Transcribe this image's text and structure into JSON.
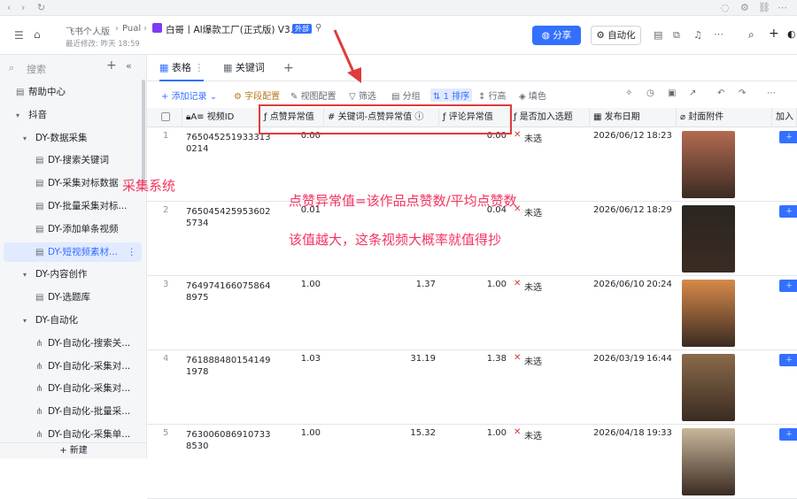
{
  "browser": {
    "back": "‹",
    "forward": "›",
    "reload": "↻"
  },
  "header": {
    "crumb1": "飞书个人版",
    "crumb2": "Pual",
    "doc_title": "白哥丨AI爆款工厂(正式版) V3.5",
    "badge": "外部",
    "last_modified": "最近修改: 昨天 18:59",
    "share": "分享",
    "automation": "自动化"
  },
  "sidebar": {
    "search": "搜索",
    "new": "新建",
    "items": [
      {
        "label": "帮助中心",
        "level": 0,
        "icon": "table-icon"
      },
      {
        "label": "抖音",
        "level": 0,
        "caret": true
      },
      {
        "label": "DY-数据采集",
        "level": 1,
        "caret": true
      },
      {
        "label": "DY-搜索关键词",
        "level": 2,
        "icon": "table-icon"
      },
      {
        "label": "DY-采集对标数据",
        "level": 2,
        "icon": "table-icon"
      },
      {
        "label": "DY-批量采集对标...",
        "level": 2,
        "icon": "table-icon"
      },
      {
        "label": "DY-添加单条视频",
        "level": 2,
        "icon": "table-icon"
      },
      {
        "label": "DY-短视频素材...",
        "level": 2,
        "icon": "table-icon",
        "active": true
      },
      {
        "label": "DY-内容创作",
        "level": 1,
        "caret": true
      },
      {
        "label": "DY-选题库",
        "level": 2,
        "icon": "table-icon"
      },
      {
        "label": "DY-自动化",
        "level": 1,
        "caret": true
      },
      {
        "label": "DY-自动化-搜索关...",
        "level": 2,
        "icon": "flow-icon"
      },
      {
        "label": "DY-自动化-采集对...",
        "level": 2,
        "icon": "flow-icon"
      },
      {
        "label": "DY-自动化-采集对...",
        "level": 2,
        "icon": "flow-icon"
      },
      {
        "label": "DY-自动化-批量采...",
        "level": 2,
        "icon": "flow-icon"
      },
      {
        "label": "DY-自动化-采集单...",
        "level": 2,
        "icon": "flow-icon"
      }
    ]
  },
  "tabs": {
    "table": "表格",
    "keyword": "关键词",
    "add": "+"
  },
  "toolbar": {
    "add_record": "添加记录",
    "field_config": "字段配置",
    "view_config": "视图配置",
    "filter": "筛选",
    "group": "分组",
    "sort": "1 排序",
    "row_height": "行高",
    "fill_color": "填色"
  },
  "columns": [
    "视频ID",
    "点赞异常值",
    "关键词-点赞异常值",
    "评论异常值",
    "是否加入选题",
    "发布日期",
    "封面附件",
    "加入"
  ],
  "rows": [
    {
      "n": "1",
      "id1": "765045251933313",
      "id2": "0214",
      "like": "0.00",
      "kw": "",
      "cm": "0.00",
      "topic": "未选",
      "date": "2026/06/12",
      "time": "18:23",
      "thumb": "#b46a52"
    },
    {
      "n": "2",
      "id1": "765045425953602",
      "id2": "5734",
      "like": "0.01",
      "kw": "",
      "cm": "0.04",
      "topic": "未选",
      "date": "2026/06/12",
      "time": "18:29",
      "thumb": "#2a2620"
    },
    {
      "n": "3",
      "id1": "764974166075864",
      "id2": "8975",
      "like": "1.00",
      "kw": "1.37",
      "cm": "1.00",
      "topic": "未选",
      "date": "2026/06/10",
      "time": "20:24",
      "thumb": "#d88a4a"
    },
    {
      "n": "4",
      "id1": "761888480154149",
      "id2": "1978",
      "like": "1.03",
      "kw": "31.19",
      "cm": "1.38",
      "topic": "未选",
      "date": "2026/03/19",
      "time": "16:44",
      "thumb": "#8a6a4a"
    },
    {
      "n": "5",
      "id1": "763006086910733",
      "id2": "8530",
      "like": "1.00",
      "kw": "15.32",
      "cm": "1.00",
      "topic": "未选",
      "date": "2026/04/18",
      "time": "19:33",
      "thumb": "#c9b79c"
    }
  ],
  "annotations": {
    "system": "采集系统",
    "formula": "点赞异常值=该作品点赞数/平均点赞数",
    "note": "该值越大，这条视频大概率就值得抄"
  },
  "colors": {
    "accent": "#3370ff",
    "annotation": "#f5345f",
    "box": "#e03b3b"
  }
}
